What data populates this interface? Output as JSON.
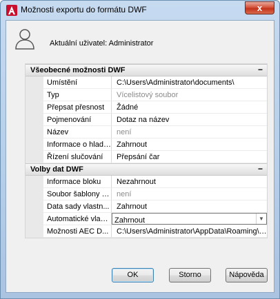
{
  "window": {
    "title": "Možnosti exportu do formátu DWF",
    "close_label": "x"
  },
  "user": {
    "label": "Aktuální uživatel: Administrator"
  },
  "sections": [
    {
      "title": "Všeobecné možnosti DWF",
      "collapse_label": "−",
      "rows": [
        {
          "name": "Umístění",
          "value": "C:\\Users\\Administrator\\documents\\"
        },
        {
          "name": "Typ",
          "value": "Vícelistový soubor"
        },
        {
          "name": "Přepsat přesnost",
          "value": "Žádné"
        },
        {
          "name": "Pojmenování",
          "value": "Dotaz na název"
        },
        {
          "name": "Název",
          "value": "není"
        },
        {
          "name": "Informace o hladi...",
          "value": "Zahrnout"
        },
        {
          "name": "Řízení slučování",
          "value": "Přepsání čar"
        }
      ]
    },
    {
      "title": "Volby dat DWF",
      "collapse_label": "−",
      "rows": [
        {
          "name": "Informace bloku",
          "value": "Nezahrnout"
        },
        {
          "name": "Soubor šablony b...",
          "value": "není"
        },
        {
          "name": "Data sady vlastn...",
          "value": "Zahrnout"
        },
        {
          "name": "Automatické vlast...",
          "value": "Zahrnout"
        },
        {
          "name": "Možnosti AEC D...",
          "value": "C:\\Users\\Administrator\\AppData\\Roaming\\A..."
        }
      ]
    }
  ],
  "buttons": {
    "ok": "OK",
    "cancel": "Storno",
    "help": "Nápověda"
  },
  "colors": {
    "title_gradient": "#b5cde8",
    "close": "#c3341c",
    "accent_border": "#3c7fb1"
  }
}
